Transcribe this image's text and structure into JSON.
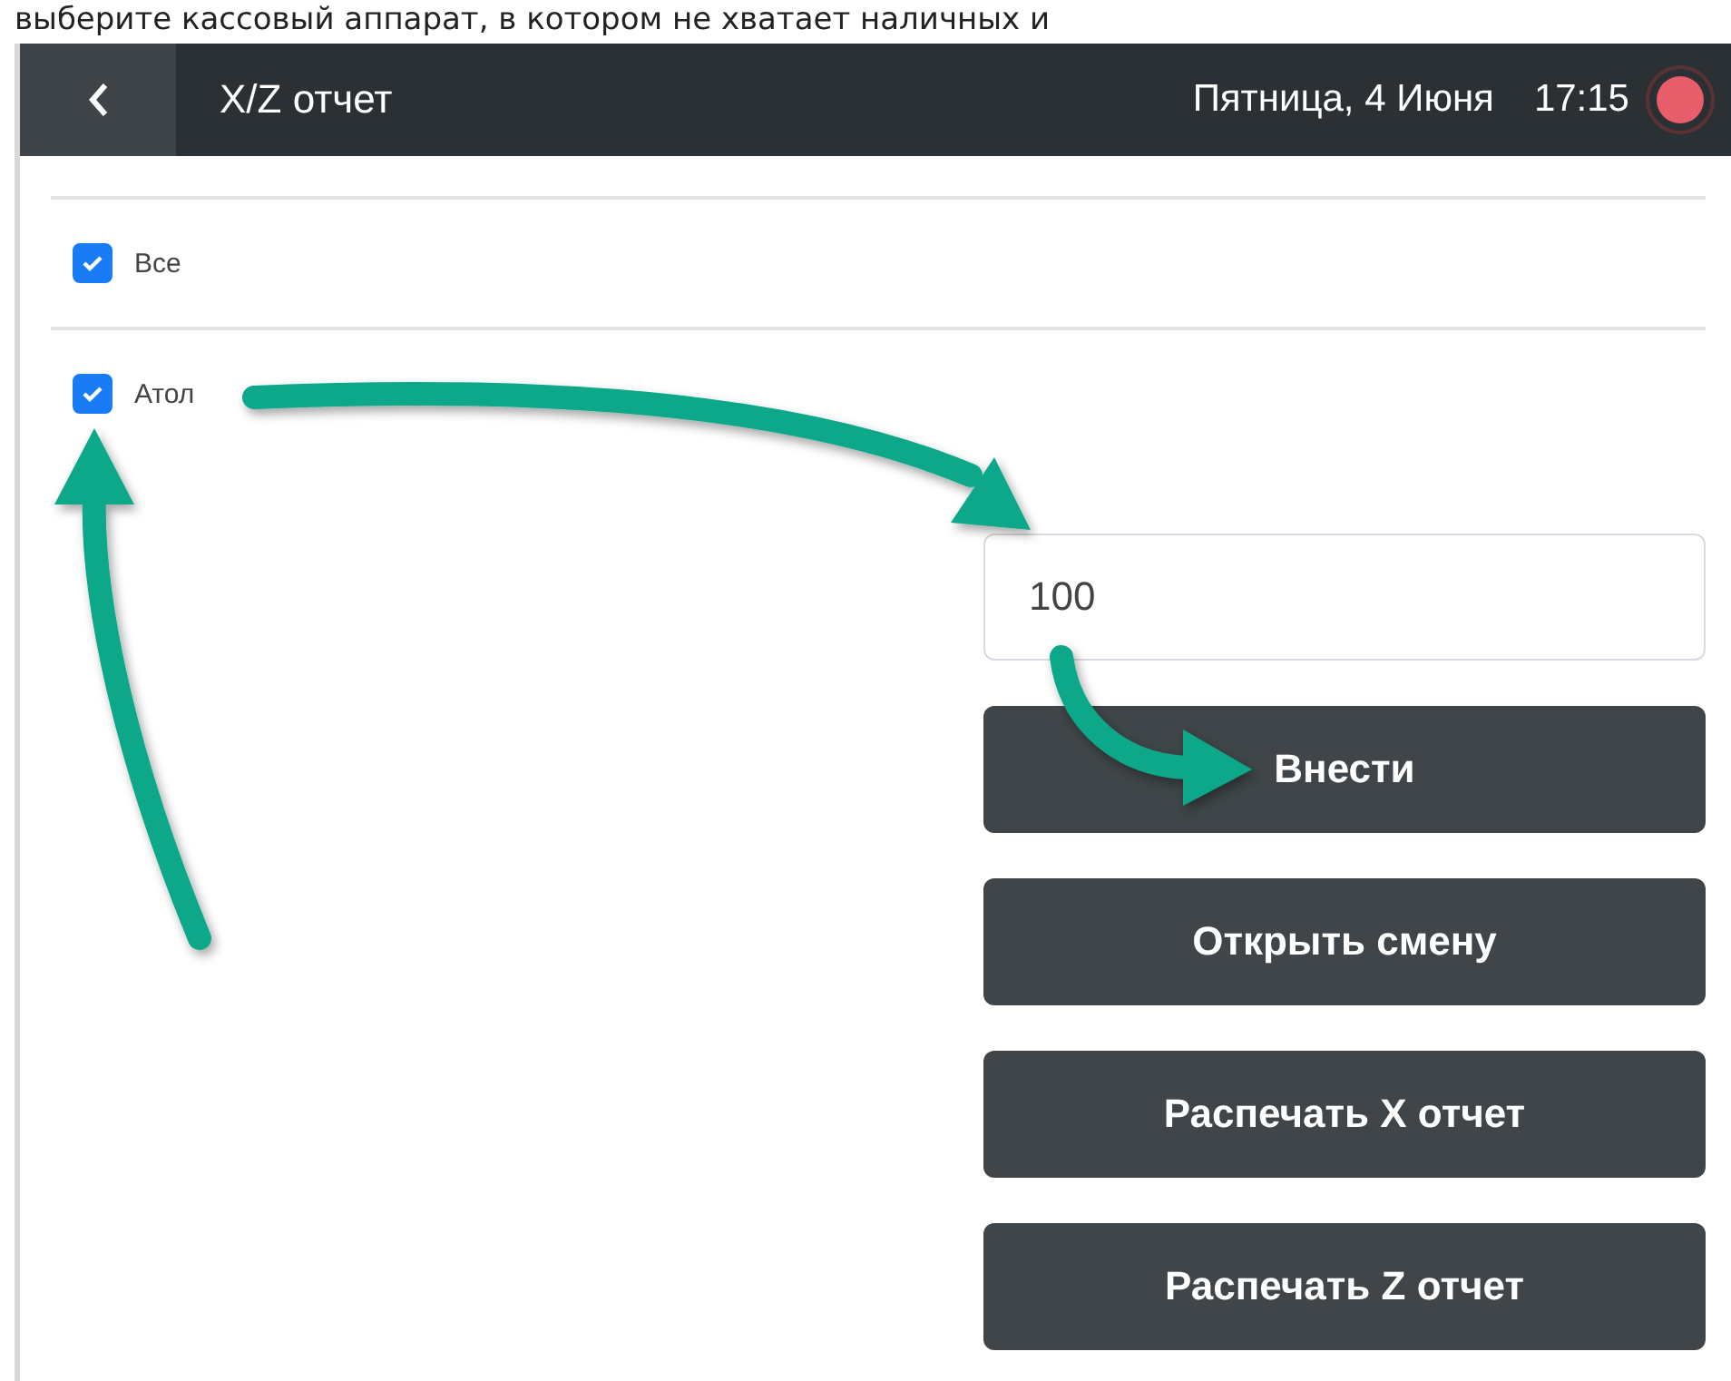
{
  "caption": "выберите кассовый аппарат, в котором не хватает наличных и",
  "header": {
    "title": "X/Z отчет",
    "date": "Пятница, 4 Июня",
    "time": "17:15"
  },
  "checkboxes": [
    {
      "label": "Все",
      "checked": true
    },
    {
      "label": "Атол",
      "checked": true
    }
  ],
  "amount_field": {
    "value": "100"
  },
  "buttons": [
    "Внести",
    "Открыть смену",
    "Распечать X отчет",
    "Распечать Z отчет"
  ]
}
